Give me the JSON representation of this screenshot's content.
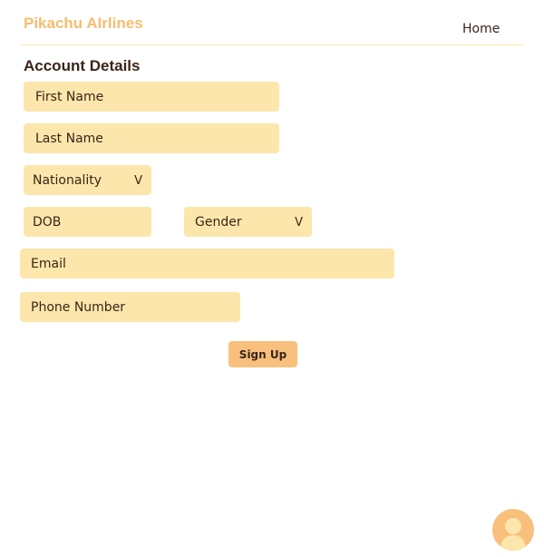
{
  "header": {
    "brand": "Pikachu AIrlines",
    "nav": {
      "home": "Home"
    }
  },
  "form": {
    "title": "Account Details",
    "fields": {
      "first_name": {
        "placeholder": "First Name"
      },
      "last_name": {
        "placeholder": "Last Name"
      },
      "nationality": {
        "placeholder": "Nationality",
        "chevron": "V"
      },
      "dob": {
        "placeholder": "DOB"
      },
      "gender": {
        "placeholder": "Gender",
        "chevron": "V"
      },
      "email": {
        "placeholder": "Email"
      },
      "phone": {
        "placeholder": "Phone Number"
      }
    },
    "submit_label": "Sign Up"
  },
  "user": {
    "avatar_icon": "user-avatar-icon"
  },
  "colors": {
    "brand": "#f5bd70",
    "field_background": "#fce6ab",
    "button_background": "#f8c07c",
    "text": "#3a2418",
    "divider": "#fbe7b3",
    "avatar_background": "#f8c07c",
    "avatar_figure": "#fce6ab"
  }
}
